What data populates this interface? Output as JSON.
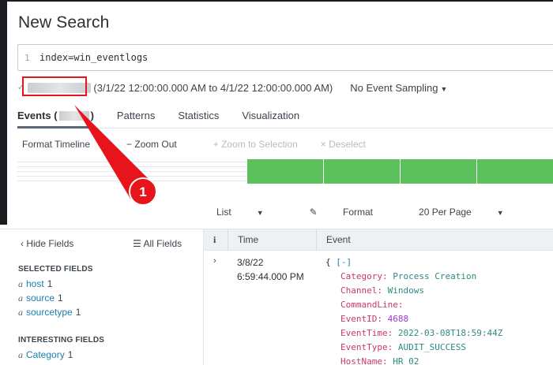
{
  "page": {
    "title": "New Search"
  },
  "search": {
    "line_number": "1",
    "query": "index=win_eventlogs"
  },
  "results": {
    "range": "(3/1/22 12:00:00.000 AM to 4/1/22 12:00:00.000 AM)",
    "sampling": "No Event Sampling"
  },
  "tabs": [
    {
      "label": "Events (",
      "suffix": ")"
    },
    {
      "label": "Patterns"
    },
    {
      "label": "Statistics"
    },
    {
      "label": "Visualization"
    }
  ],
  "timeline_toolbar": {
    "format": "Format Timeline",
    "zoom_out": "− Zoom Out",
    "zoom_selection": "+ Zoom to Selection",
    "deselect": "× Deselect"
  },
  "timeline_bars": {
    "count": 4,
    "color": "#5cc05c"
  },
  "annotation": {
    "marker": "1",
    "color": "#e8141c"
  },
  "list_toolbar": {
    "list": "List",
    "format": "Format",
    "per_page": "20 Per Page"
  },
  "fields": {
    "hide": "Hide Fields",
    "all": "All Fields",
    "selected_heading": "SELECTED FIELDS",
    "selected": [
      {
        "type": "a",
        "name": "host",
        "count": "1"
      },
      {
        "type": "a",
        "name": "source",
        "count": "1"
      },
      {
        "type": "a",
        "name": "sourcetype",
        "count": "1"
      }
    ],
    "interesting_heading": "INTERESTING FIELDS",
    "interesting": [
      {
        "type": "a",
        "name": "Category",
        "count": "1"
      }
    ]
  },
  "table": {
    "col_info": "i",
    "col_time": "Time",
    "col_event": "Event",
    "row": {
      "date": "3/8/22",
      "time": "6:59:44.000 PM",
      "open_brace": "{",
      "collapse": "[-]",
      "fields": [
        {
          "key": "Category",
          "value": "Process Creation",
          "kind": "str"
        },
        {
          "key": "Channel",
          "value": "Windows",
          "kind": "str"
        },
        {
          "key": "CommandLine",
          "value": "",
          "kind": "str"
        },
        {
          "key": "EventID",
          "value": "4688",
          "kind": "num"
        },
        {
          "key": "EventTime",
          "value": "2022-03-08T18:59:44Z",
          "kind": "str"
        },
        {
          "key": "EventType",
          "value": "AUDIT_SUCCESS",
          "kind": "str"
        },
        {
          "key": "HostName",
          "value": "HR_02",
          "kind": "str"
        }
      ]
    }
  }
}
